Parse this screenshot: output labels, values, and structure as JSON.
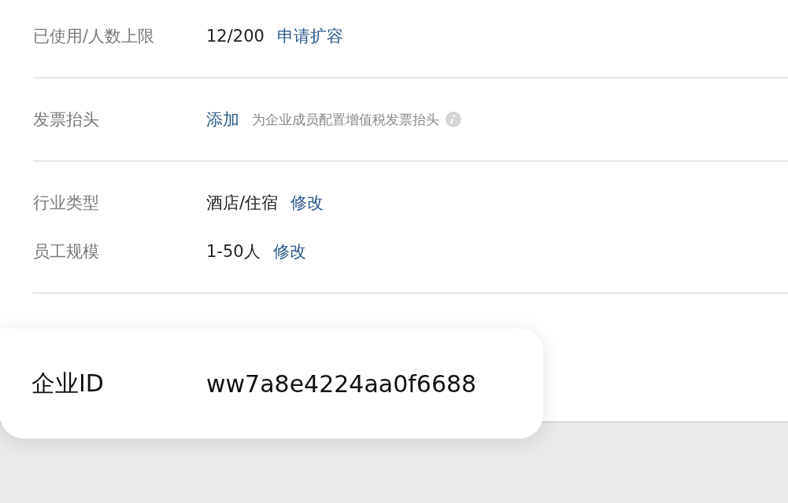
{
  "groups": [
    {
      "rows": [
        {
          "label": "已使用/人数上限",
          "value": "12/200",
          "link": "申请扩容"
        }
      ]
    },
    {
      "rows": [
        {
          "label": "发票抬头",
          "link": "添加",
          "hint": "为企业成员配置增值税发票抬头",
          "info_icon": true
        }
      ]
    },
    {
      "rows": [
        {
          "label": "行业类型",
          "value": "酒店/住宿",
          "link": "修改"
        },
        {
          "label": "员工规模",
          "value": "1-50人",
          "link": "修改"
        }
      ]
    }
  ],
  "id_card": {
    "label": "企业ID",
    "value": "ww7a8e4224aa0f6688"
  }
}
